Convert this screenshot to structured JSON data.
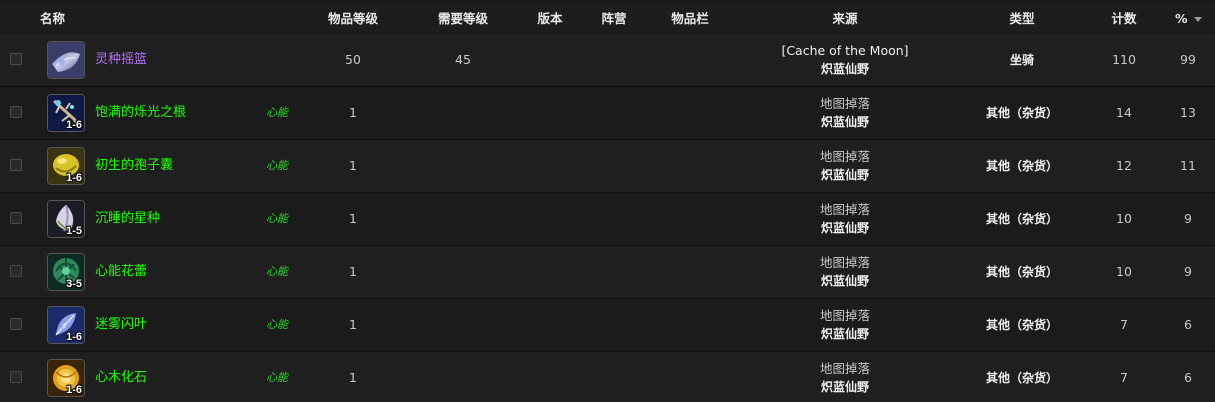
{
  "headers": {
    "name": "名称",
    "item_level": "物品等级",
    "req_level": "需要等级",
    "version": "版本",
    "faction": "阵营",
    "slot": "物品栏",
    "source": "来源",
    "type": "类型",
    "count": "计数",
    "percent": "%"
  },
  "rows": [
    {
      "name": "灵种摇篮",
      "quality": "epic",
      "tag": "",
      "item_level": "50",
      "req_level": "45",
      "source_line1": "[Cache of the Moon]",
      "source_line2": "炽蓝仙野",
      "type": "坐骑",
      "count": "110",
      "percent": "99",
      "stack": "",
      "icon": "cradle-icon"
    },
    {
      "name": "饱满的烁光之根",
      "quality": "uncommon",
      "tag": "心能",
      "item_level": "1",
      "req_level": "",
      "source_line1": "地图掉落",
      "source_line2": "炽蓝仙野",
      "type": "其他（杂货）",
      "count": "14",
      "percent": "13",
      "stack": "1-6",
      "icon": "root-icon"
    },
    {
      "name": "初生的孢子囊",
      "quality": "uncommon",
      "tag": "心能",
      "item_level": "1",
      "req_level": "",
      "source_line1": "地图掉落",
      "source_line2": "炽蓝仙野",
      "type": "其他（杂货）",
      "count": "12",
      "percent": "11",
      "stack": "1-6",
      "icon": "spore-sac-icon"
    },
    {
      "name": "沉睡的星种",
      "quality": "uncommon",
      "tag": "心能",
      "item_level": "1",
      "req_level": "",
      "source_line1": "地图掉落",
      "source_line2": "炽蓝仙野",
      "type": "其他（杂货）",
      "count": "10",
      "percent": "9",
      "stack": "1-5",
      "icon": "star-seed-icon"
    },
    {
      "name": "心能花蕾",
      "quality": "uncommon",
      "tag": "心能",
      "item_level": "1",
      "req_level": "",
      "source_line1": "地图掉落",
      "source_line2": "炽蓝仙野",
      "type": "其他（杂货）",
      "count": "10",
      "percent": "9",
      "stack": "3-5",
      "icon": "flower-bud-icon"
    },
    {
      "name": "迷雾闪叶",
      "quality": "uncommon",
      "tag": "心能",
      "item_level": "1",
      "req_level": "",
      "source_line1": "地图掉落",
      "source_line2": "炽蓝仙野",
      "type": "其他（杂货）",
      "count": "7",
      "percent": "6",
      "stack": "1-6",
      "icon": "mist-leaf-icon"
    },
    {
      "name": "心木化石",
      "quality": "uncommon",
      "tag": "心能",
      "item_level": "1",
      "req_level": "",
      "source_line1": "地图掉落",
      "source_line2": "炽蓝仙野",
      "type": "其他（杂货）",
      "count": "7",
      "percent": "6",
      "stack": "1-6",
      "icon": "heartwood-fossil-icon"
    }
  ]
}
